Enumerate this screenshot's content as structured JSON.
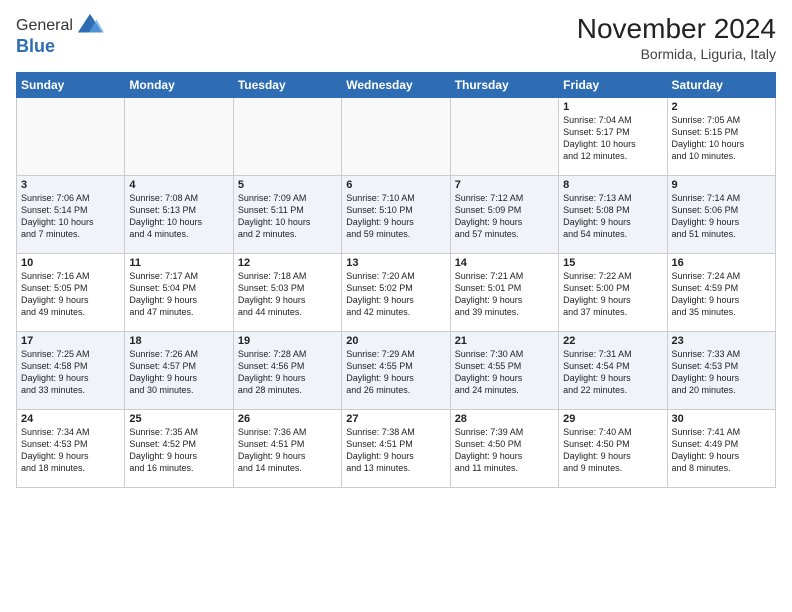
{
  "logo": {
    "general": "General",
    "blue": "Blue"
  },
  "header": {
    "month": "November 2024",
    "location": "Bormida, Liguria, Italy"
  },
  "weekdays": [
    "Sunday",
    "Monday",
    "Tuesday",
    "Wednesday",
    "Thursday",
    "Friday",
    "Saturday"
  ],
  "weeks": [
    [
      {
        "day": "",
        "info": ""
      },
      {
        "day": "",
        "info": ""
      },
      {
        "day": "",
        "info": ""
      },
      {
        "day": "",
        "info": ""
      },
      {
        "day": "",
        "info": ""
      },
      {
        "day": "1",
        "info": "Sunrise: 7:04 AM\nSunset: 5:17 PM\nDaylight: 10 hours\nand 12 minutes."
      },
      {
        "day": "2",
        "info": "Sunrise: 7:05 AM\nSunset: 5:15 PM\nDaylight: 10 hours\nand 10 minutes."
      }
    ],
    [
      {
        "day": "3",
        "info": "Sunrise: 7:06 AM\nSunset: 5:14 PM\nDaylight: 10 hours\nand 7 minutes."
      },
      {
        "day": "4",
        "info": "Sunrise: 7:08 AM\nSunset: 5:13 PM\nDaylight: 10 hours\nand 4 minutes."
      },
      {
        "day": "5",
        "info": "Sunrise: 7:09 AM\nSunset: 5:11 PM\nDaylight: 10 hours\nand 2 minutes."
      },
      {
        "day": "6",
        "info": "Sunrise: 7:10 AM\nSunset: 5:10 PM\nDaylight: 9 hours\nand 59 minutes."
      },
      {
        "day": "7",
        "info": "Sunrise: 7:12 AM\nSunset: 5:09 PM\nDaylight: 9 hours\nand 57 minutes."
      },
      {
        "day": "8",
        "info": "Sunrise: 7:13 AM\nSunset: 5:08 PM\nDaylight: 9 hours\nand 54 minutes."
      },
      {
        "day": "9",
        "info": "Sunrise: 7:14 AM\nSunset: 5:06 PM\nDaylight: 9 hours\nand 51 minutes."
      }
    ],
    [
      {
        "day": "10",
        "info": "Sunrise: 7:16 AM\nSunset: 5:05 PM\nDaylight: 9 hours\nand 49 minutes."
      },
      {
        "day": "11",
        "info": "Sunrise: 7:17 AM\nSunset: 5:04 PM\nDaylight: 9 hours\nand 47 minutes."
      },
      {
        "day": "12",
        "info": "Sunrise: 7:18 AM\nSunset: 5:03 PM\nDaylight: 9 hours\nand 44 minutes."
      },
      {
        "day": "13",
        "info": "Sunrise: 7:20 AM\nSunset: 5:02 PM\nDaylight: 9 hours\nand 42 minutes."
      },
      {
        "day": "14",
        "info": "Sunrise: 7:21 AM\nSunset: 5:01 PM\nDaylight: 9 hours\nand 39 minutes."
      },
      {
        "day": "15",
        "info": "Sunrise: 7:22 AM\nSunset: 5:00 PM\nDaylight: 9 hours\nand 37 minutes."
      },
      {
        "day": "16",
        "info": "Sunrise: 7:24 AM\nSunset: 4:59 PM\nDaylight: 9 hours\nand 35 minutes."
      }
    ],
    [
      {
        "day": "17",
        "info": "Sunrise: 7:25 AM\nSunset: 4:58 PM\nDaylight: 9 hours\nand 33 minutes."
      },
      {
        "day": "18",
        "info": "Sunrise: 7:26 AM\nSunset: 4:57 PM\nDaylight: 9 hours\nand 30 minutes."
      },
      {
        "day": "19",
        "info": "Sunrise: 7:28 AM\nSunset: 4:56 PM\nDaylight: 9 hours\nand 28 minutes."
      },
      {
        "day": "20",
        "info": "Sunrise: 7:29 AM\nSunset: 4:55 PM\nDaylight: 9 hours\nand 26 minutes."
      },
      {
        "day": "21",
        "info": "Sunrise: 7:30 AM\nSunset: 4:55 PM\nDaylight: 9 hours\nand 24 minutes."
      },
      {
        "day": "22",
        "info": "Sunrise: 7:31 AM\nSunset: 4:54 PM\nDaylight: 9 hours\nand 22 minutes."
      },
      {
        "day": "23",
        "info": "Sunrise: 7:33 AM\nSunset: 4:53 PM\nDaylight: 9 hours\nand 20 minutes."
      }
    ],
    [
      {
        "day": "24",
        "info": "Sunrise: 7:34 AM\nSunset: 4:53 PM\nDaylight: 9 hours\nand 18 minutes."
      },
      {
        "day": "25",
        "info": "Sunrise: 7:35 AM\nSunset: 4:52 PM\nDaylight: 9 hours\nand 16 minutes."
      },
      {
        "day": "26",
        "info": "Sunrise: 7:36 AM\nSunset: 4:51 PM\nDaylight: 9 hours\nand 14 minutes."
      },
      {
        "day": "27",
        "info": "Sunrise: 7:38 AM\nSunset: 4:51 PM\nDaylight: 9 hours\nand 13 minutes."
      },
      {
        "day": "28",
        "info": "Sunrise: 7:39 AM\nSunset: 4:50 PM\nDaylight: 9 hours\nand 11 minutes."
      },
      {
        "day": "29",
        "info": "Sunrise: 7:40 AM\nSunset: 4:50 PM\nDaylight: 9 hours\nand 9 minutes."
      },
      {
        "day": "30",
        "info": "Sunrise: 7:41 AM\nSunset: 4:49 PM\nDaylight: 9 hours\nand 8 minutes."
      }
    ]
  ]
}
